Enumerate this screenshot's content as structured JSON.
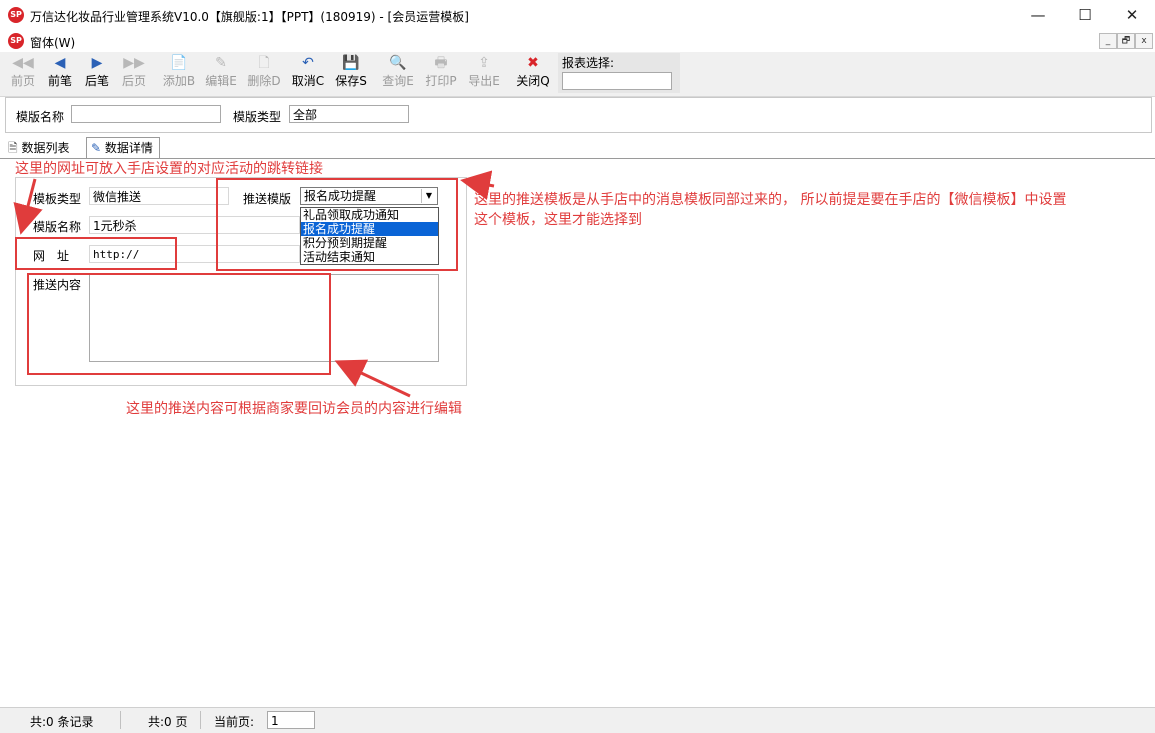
{
  "window": {
    "title": "万信达化妆品行业管理系统V10.0【旗舰版:1】【PPT】(180919) - [会员运营模板]",
    "logo_text": "SP",
    "minimize": "—",
    "maximize": "☐",
    "close": "✕"
  },
  "menu": {
    "item": "窗体(W)",
    "mdi": [
      "_",
      "🗗",
      "x"
    ]
  },
  "toolbar": {
    "buttons": [
      {
        "label": "前页",
        "icon": "◀◀",
        "enabled": false
      },
      {
        "label": "前笔",
        "icon": "◀",
        "enabled": true
      },
      {
        "label": "后笔",
        "icon": "▶",
        "enabled": true
      },
      {
        "label": "后页",
        "icon": "▶▶",
        "enabled": false
      },
      {
        "label": "添加B",
        "icon": "📄",
        "enabled": false
      },
      {
        "label": "编辑E",
        "icon": "✎",
        "enabled": false
      },
      {
        "label": "删除D",
        "icon": "🗋",
        "enabled": false
      },
      {
        "label": "取消C",
        "icon": "↶",
        "enabled": true
      },
      {
        "label": "保存S",
        "icon": "💾",
        "enabled": true
      },
      {
        "label": "查询E",
        "icon": "🔍",
        "enabled": false
      },
      {
        "label": "打印P",
        "icon": "🖶",
        "enabled": false
      },
      {
        "label": "导出E",
        "icon": "⇪",
        "enabled": false
      },
      {
        "label": "关闭Q",
        "icon": "✖",
        "enabled": true
      }
    ],
    "report_label": "报表选择:",
    "report_value": ""
  },
  "filter": {
    "name_label": "模版名称",
    "name_value": "",
    "type_label": "模版类型",
    "type_value": "全部"
  },
  "tabs": [
    {
      "label": "数据列表",
      "active": false
    },
    {
      "label": "数据详情",
      "active": true
    }
  ],
  "detail": {
    "template_type_label": "模板类型",
    "template_type_value": "微信推送",
    "push_template_label": "推送模版",
    "push_template_value": "报名成功提醒",
    "push_template_options": [
      "礼品领取成功通知",
      "报名成功提醒",
      "积分预到期提醒",
      "活动结束通知"
    ],
    "push_template_selected": 1,
    "template_name_label": "模版名称",
    "template_name_value": "1元秒杀",
    "url_label": "网　址",
    "url_value": "http://",
    "content_label": "推送内容",
    "content_value": ""
  },
  "annotations": {
    "url_note": "这里的网址可放入手店设置的对应活动的跳转链接",
    "template_note_line1": "这里的推送模板是从手店中的消息模板同部过来的， 所以前提是要在手店的【微信模板】中设置",
    "template_note_line2": "这个模板，这里才能选择到",
    "content_note": "这里的推送内容可根据商家要回访会员的内容进行编辑",
    "color": "#e03c3c"
  },
  "status": {
    "records": "共:0 条记录",
    "pages": "共:0 页",
    "current_label": "当前页:",
    "current_value": "1"
  }
}
